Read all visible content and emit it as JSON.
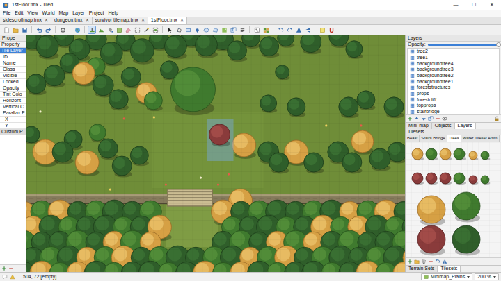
{
  "window": {
    "title": "1stFloor.tmx - Tiled",
    "controls": [
      "—",
      "☐",
      "✕"
    ]
  },
  "menu": [
    "File",
    "Edit",
    "View",
    "World",
    "Map",
    "Layer",
    "Project",
    "Help"
  ],
  "tabs": [
    {
      "label": "sidescrollmap.tmx",
      "close": "✕",
      "selected": false
    },
    {
      "label": "dungeon.tmx",
      "close": "✕",
      "selected": false
    },
    {
      "label": "survivor tilemap.tmx",
      "close": "✕",
      "selected": false
    },
    {
      "label": "1stFloor.tmx",
      "close": "✕",
      "selected": true
    }
  ],
  "toolbar": {
    "tools": [
      {
        "selected": false
      },
      {
        "selected": false
      },
      {
        "selected": false
      },
      {
        "selected": false
      },
      {
        "selected": false
      },
      {
        "selected": false
      },
      {
        "selected": false
      },
      {
        "selected": true
      },
      {
        "selected": false
      },
      {
        "selected": false
      },
      {
        "selected": false
      },
      {
        "selected": false
      },
      {
        "selected": false
      },
      {
        "selected": false
      },
      {
        "selected": false
      },
      {
        "selected": false
      },
      {
        "selected": false
      },
      {
        "selected": false
      },
      {
        "selected": false
      },
      {
        "selected": false
      },
      {
        "selected": false
      },
      {
        "selected": false
      },
      {
        "selected": false
      },
      {
        "selected": false
      },
      {
        "selected": false
      },
      {
        "selected": false
      },
      {
        "selected": false
      },
      {
        "selected": false
      },
      {
        "selected": false
      },
      {
        "selected": false
      },
      {
        "selected": false
      },
      {
        "selected": false
      }
    ]
  },
  "properties": {
    "title": "Prope",
    "column": "Property",
    "rows": [
      {
        "label": "Tile Layer",
        "kind": "current",
        "selected": true
      },
      {
        "label": "ID",
        "kind": "row",
        "selected": false
      },
      {
        "label": "Name",
        "kind": "row",
        "selected": false
      },
      {
        "label": "Class",
        "kind": "row",
        "selected": false
      },
      {
        "label": "Visible",
        "kind": "row",
        "selected": false
      },
      {
        "label": "Locked",
        "kind": "row",
        "selected": false
      },
      {
        "label": "Opacity",
        "kind": "row",
        "selected": false
      },
      {
        "label": "Tint Colo",
        "kind": "row",
        "selected": false
      },
      {
        "label": "Horizont",
        "kind": "row",
        "selected": false
      },
      {
        "label": "Vertical C",
        "kind": "row",
        "selected": false
      },
      {
        "label": "Parallax F",
        "kind": "row",
        "selected": false
      },
      {
        "label": "X",
        "kind": "subrow",
        "selected": false
      },
      {
        "label": "Y",
        "kind": "subrow",
        "selected": false
      },
      {
        "label": "Custom P",
        "kind": "group",
        "selected": false
      }
    ]
  },
  "layers": {
    "title": "Layers",
    "opacity_label": "Opacity:",
    "opacity": {
      "level": 1
    },
    "items": [
      {
        "name": "tree2"
      },
      {
        "name": "tree1"
      },
      {
        "name": "backgroundtree4"
      },
      {
        "name": "backgroundtree3"
      },
      {
        "name": "backgroundtree2"
      },
      {
        "name": "backgroundtree1"
      },
      {
        "name": "foreststructures"
      },
      {
        "name": "props"
      },
      {
        "name": "forestcliff"
      },
      {
        "name": "topprops"
      },
      {
        "name": "stairbridge"
      }
    ]
  },
  "layer_dock_tabs": [
    {
      "label": "Mini-map",
      "selected": false
    },
    {
      "label": "Objects",
      "selected": false
    },
    {
      "label": "Layers",
      "selected": true
    }
  ],
  "tilesets": {
    "title": "Tilesets",
    "tabs": [
      {
        "label": "Beast",
        "selected": false
      },
      {
        "label": "Stairs Bridge",
        "selected": false
      },
      {
        "label": "Trees",
        "selected": true
      },
      {
        "label": "Water Tileset Anim",
        "selected": false
      }
    ]
  },
  "tileset_dock_tabs": [
    {
      "label": "Terrain Sets",
      "selected": false
    },
    {
      "label": "Tilesets",
      "selected": true
    }
  ],
  "status": {
    "position": "504, 72 [empty]",
    "map": "Minimap_Plains",
    "zoom": "200 %"
  }
}
